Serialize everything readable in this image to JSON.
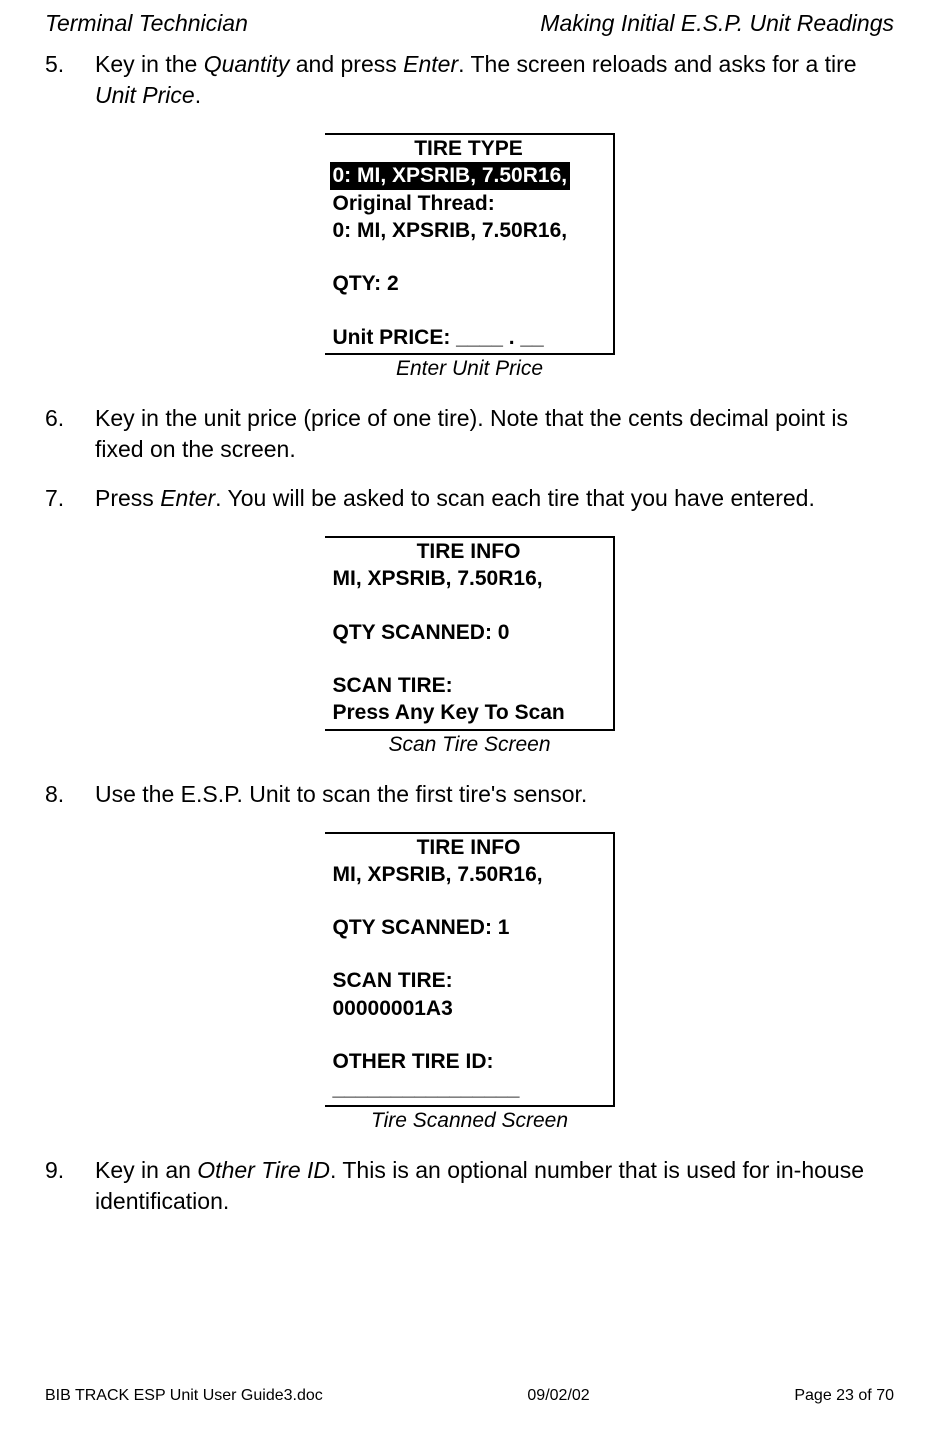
{
  "header": {
    "left": "Terminal Technician",
    "right": "Making Initial E.S.P. Unit Readings"
  },
  "step5": {
    "num": "5.",
    "pre": "Key in the ",
    "italic1": "Quantity",
    "mid1": " and press ",
    "italic2": "Enter",
    "mid2": ".  The screen reloads and asks for a tire ",
    "italic3": "Unit Price",
    "post": "."
  },
  "screen1": {
    "title": "TIRE TYPE",
    "line1": "0: MI, XPSRIB, 7.50R16,",
    "line2": "Original Thread:",
    "line3": "0: MI, XPSRIB, 7.50R16,",
    "line4": "QTY: 2",
    "line5": "Unit PRICE: ____ . __",
    "caption": "Enter Unit Price"
  },
  "step6": {
    "num": "6.",
    "text": "Key in the unit price (price of one tire).  Note that the cents decimal point is fixed on the screen."
  },
  "step7": {
    "num": "7.",
    "pre": "Press ",
    "italic1": "Enter",
    "post": ".  You will be asked to scan each tire that you have entered."
  },
  "screen2": {
    "title": "TIRE INFO",
    "line1": "MI, XPSRIB, 7.50R16,",
    "line2": "QTY SCANNED:  0",
    "line3": "SCAN TIRE:",
    "line4": "Press Any Key To Scan",
    "caption": "Scan Tire Screen"
  },
  "step8": {
    "num": "8.",
    "text": "Use the E.S.P. Unit to scan the first tire's sensor."
  },
  "screen3": {
    "title": "TIRE INFO",
    "line1": "MI, XPSRIB, 7.50R16,",
    "line2": "QTY SCANNED:  1",
    "line3": "SCAN TIRE:",
    "line4": "00000001A3",
    "line5": "OTHER TIRE ID:",
    "line6": "________________",
    "caption": "Tire Scanned Screen"
  },
  "step9": {
    "num": "9.",
    "pre": "Key in an ",
    "italic1": "Other Tire ID",
    "post": ".  This is an optional number that is used for in-house identification."
  },
  "footer": {
    "left": "BIB TRACK  ESP Unit User Guide3.doc",
    "center": "09/02/02",
    "right": "Page 23 of 70"
  }
}
